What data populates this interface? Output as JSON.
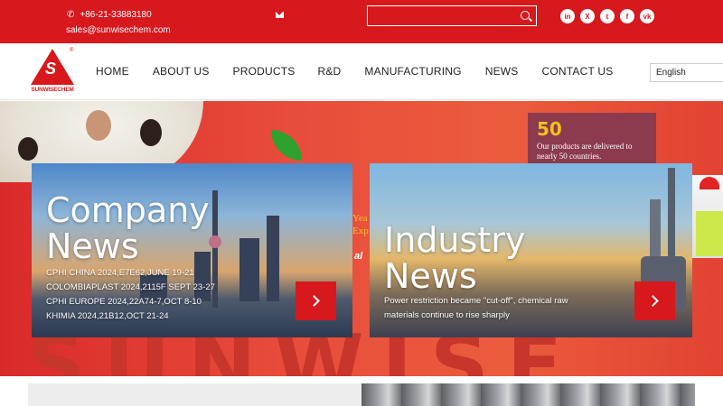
{
  "topbar": {
    "phone": "+86-21-33883180",
    "email": "sales@sunwisechem.com",
    "search_placeholder": "",
    "socials": [
      "in",
      "X",
      "t",
      "f",
      "vk"
    ],
    "brand_color": "#d7181d"
  },
  "logo": {
    "name": "SUNWISECHEM",
    "mark": "S",
    "reg": "®"
  },
  "nav": {
    "items": [
      "HOME",
      "ABOUT US",
      "PRODUCTS",
      "R&D",
      "MANUFACTURING",
      "NEWS",
      "CONTACT US"
    ],
    "language": "English"
  },
  "hero": {
    "stat_number": "50",
    "stat_text": "Our products are delivered to nearly 50 countries.",
    "side_text_1": "Yea",
    "side_text_2": "Exp",
    "side_text_3": "al",
    "big_letters": "SUNWISE"
  },
  "cards": {
    "company": {
      "title_line1": "Company",
      "title_line2": "News",
      "lines": [
        "CPHI CHINA 2024,E7E62,JUNE 19-21",
        "COLOMBIAPLAST 2024,2115F SEPT 23-27",
        "CPHI EUROPE 2024,22A74-7,OCT 8-10",
        "KHIMIA 2024,21B12,OCT 21-24"
      ]
    },
    "industry": {
      "title_line1": "Industry",
      "title_line2": "News",
      "lines": [
        "Power restriction became \"cut-off\", chemical raw",
        "materials continue to rise sharply"
      ]
    }
  }
}
